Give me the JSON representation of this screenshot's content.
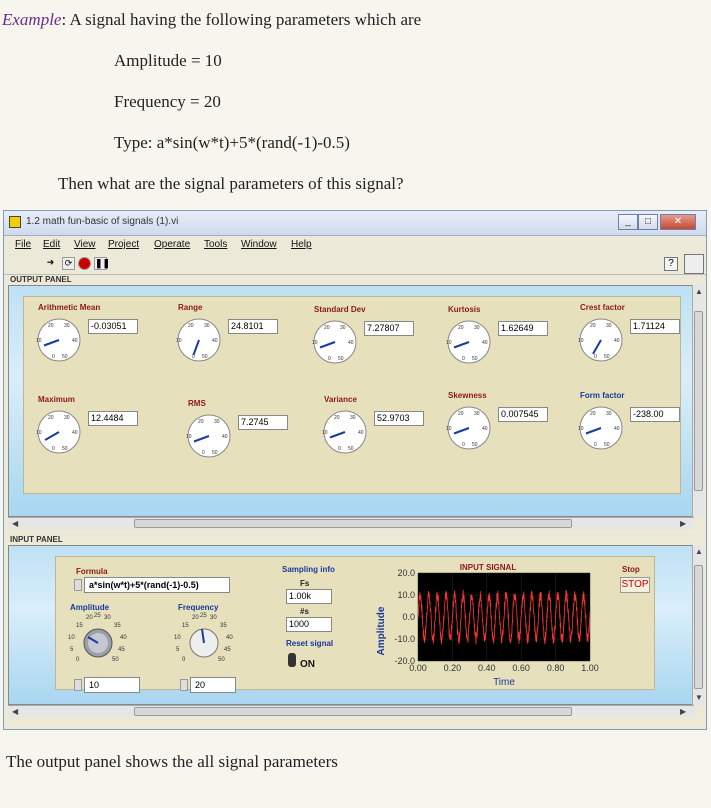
{
  "document": {
    "example_label": "Example",
    "example_text": ": A signal having the following parameters which are",
    "amplitude_line": "Amplitude = 10",
    "frequency_line": "Frequency = 20",
    "type_line": "Type:  a*sin(w*t)+5*(rand(-1)-0.5)",
    "question": "Then what are the signal parameters of this signal?",
    "footer": "The output panel shows the all signal parameters"
  },
  "window": {
    "title": "1.2 math fun-basic of signals (1).vi",
    "menu": [
      "File",
      "Edit",
      "View",
      "Project",
      "Operate",
      "Tools",
      "Window",
      "Help"
    ],
    "help_icon": "?"
  },
  "output_panel": {
    "label": "OUTPUT PANEL",
    "gauges": [
      {
        "name": "Arithmetic Mean",
        "value": "-0.03051",
        "color": "red"
      },
      {
        "name": "Range",
        "value": "24.8101",
        "color": "red"
      },
      {
        "name": "Standard Dev",
        "value": "7.27807",
        "color": "red"
      },
      {
        "name": "Kurtosis",
        "value": "1.62649",
        "color": "red"
      },
      {
        "name": "Crest factor",
        "value": "1.71124",
        "color": "red"
      },
      {
        "name": "Maximum",
        "value": "12.4484",
        "color": "red"
      },
      {
        "name": "RMS",
        "value": "7.2745",
        "color": "red"
      },
      {
        "name": "Variance",
        "value": "52.9703",
        "color": "red"
      },
      {
        "name": "Skewness",
        "value": "0.007545",
        "color": "red"
      },
      {
        "name": "Form factor",
        "value": "-238.00",
        "color": "blue"
      }
    ],
    "dial_labels": {
      "t1": "20",
      "t2": "30",
      "l": "10",
      "r": "40",
      "b0": "0",
      "b50": "50"
    }
  },
  "input_panel": {
    "label": "INPUT PANEL",
    "formula_label": "Formula",
    "formula_value": "a*sin(w*t)+5*(rand(-1)-0.5)",
    "amplitude_label": "Amplitude",
    "amplitude_value": "10",
    "frequency_label": "Frequency",
    "frequency_value": "20",
    "knob_ticks": {
      "a": "20",
      "b": "25",
      "c": "30",
      "d": "15",
      "e": "35",
      "f": "10",
      "g": "40",
      "h": "5",
      "i": "45",
      "j": "0",
      "k": "50"
    },
    "sampling_info_label": "Sampling info",
    "fs_label": "Fs",
    "fs_value": "1.00k",
    "ns_label": "#s",
    "ns_value": "1000",
    "reset_label": "Reset signal",
    "reset_state": "ON",
    "stop_label": "Stop",
    "stop_button": "STOP"
  },
  "chart_data": {
    "type": "line",
    "title": "INPUT SIGNAL",
    "xlabel": "Time",
    "ylabel": "Amplitude",
    "xlim": [
      0,
      1
    ],
    "ylim": [
      -20,
      20
    ],
    "x_ticks": [
      "0.00",
      "0.20",
      "0.40",
      "0.60",
      "0.80",
      "1.00"
    ],
    "y_ticks": [
      "20.0",
      "10.0",
      "0.0",
      "-10.0",
      "-20.0"
    ],
    "signal": {
      "amplitude": 10,
      "frequency": 20,
      "noise_amplitude": 5
    },
    "colors": {
      "background": "#000000",
      "line": "#ff3333"
    }
  }
}
